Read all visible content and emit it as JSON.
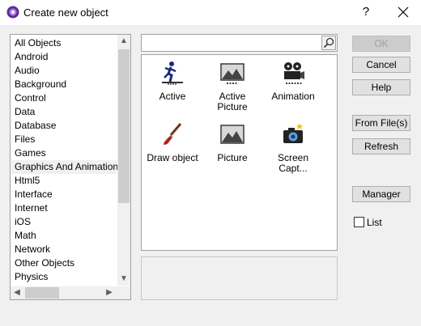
{
  "window": {
    "title": "Create new object",
    "help_label": "?"
  },
  "categories": {
    "items": [
      "All Objects",
      "Android",
      "Audio",
      "Background",
      "Control",
      "Data",
      "Database",
      "Files",
      "Games",
      "Graphics And Animations",
      "Html5",
      "Interface",
      "Internet",
      "iOS",
      "Math",
      "Network",
      "Other Objects",
      "Physics"
    ],
    "selected": "Graphics And Animations"
  },
  "search": {
    "value": "",
    "placeholder": ""
  },
  "objects": [
    {
      "label": "Active",
      "icon": "running-man-icon"
    },
    {
      "label": "Active Picture",
      "icon": "landscape-picture-icon"
    },
    {
      "label": "Animation",
      "icon": "film-projector-icon"
    },
    {
      "label": "Draw object",
      "icon": "paintbrush-icon"
    },
    {
      "label": "Picture",
      "icon": "landscape-picture-icon"
    },
    {
      "label": "Screen Capt...",
      "icon": "camera-icon"
    }
  ],
  "buttons": {
    "ok": "OK",
    "cancel": "Cancel",
    "help": "Help",
    "from_files": "From File(s)",
    "refresh": "Refresh",
    "manager": "Manager"
  },
  "list_checkbox": {
    "label": "List",
    "checked": false
  },
  "colors": {
    "background": "#f0f0f0",
    "panel": "#ffffff",
    "border": "#a0a0a0",
    "disabled_text": "#a0a0a0"
  }
}
